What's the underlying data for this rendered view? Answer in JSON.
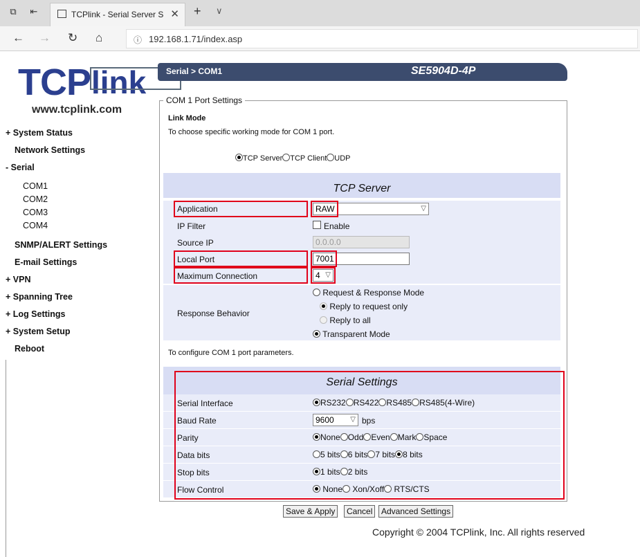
{
  "browser": {
    "tab_title": "TCPlink - Serial Server S",
    "url": "192.168.1.71/index.asp"
  },
  "sidebar": {
    "logo_tcp": "TCP",
    "logo_link": "link",
    "website": "www.tcplink.com",
    "items": [
      {
        "label": "System Status",
        "prefix": "+"
      },
      {
        "label": "Network Settings",
        "prefix": ""
      },
      {
        "label": "Serial",
        "prefix": "-"
      },
      {
        "label": "SNMP/ALERT Settings",
        "prefix": ""
      },
      {
        "label": "E-mail Settings",
        "prefix": ""
      },
      {
        "label": "VPN",
        "prefix": "+"
      },
      {
        "label": "Spanning Tree",
        "prefix": "+"
      },
      {
        "label": "Log Settings",
        "prefix": "+"
      },
      {
        "label": "System Setup",
        "prefix": "+"
      },
      {
        "label": "Reboot",
        "prefix": ""
      }
    ],
    "serial_sub": [
      "COM1",
      "COM2",
      "COM3",
      "COM4"
    ]
  },
  "header": {
    "breadcrumb": "Serial > COM1",
    "model": "SE5904D-4P"
  },
  "port_settings": {
    "legend": "COM 1 Port Settings",
    "link_mode_title": "Link Mode",
    "link_mode_desc": "To choose specific working mode for COM 1 port.",
    "modes": [
      "TCP Server",
      "TCP Client",
      "UDP"
    ],
    "selected_mode": "TCP Server"
  },
  "tcp_server": {
    "title": "TCP Server",
    "application_label": "Application",
    "application_value": "RAW",
    "ip_filter_label": "IP Filter",
    "ip_filter_option": "Enable",
    "source_ip_label": "Source IP",
    "source_ip_value": "0.0.0.0",
    "local_port_label": "Local Port",
    "local_port_value": "7001",
    "max_conn_label": "Maximum Connection",
    "max_conn_value": "4",
    "response_label": "Response Behavior",
    "response_opt1": "Request & Response Mode",
    "response_opt1a": "Reply to request only",
    "response_opt1b": "Reply to all",
    "response_opt2": "Transparent Mode"
  },
  "serial_note": "To configure COM 1 port parameters.",
  "serial_settings": {
    "title": "Serial Settings",
    "interface_label": "Serial Interface",
    "interfaces": [
      "RS232",
      "RS422",
      "RS485",
      "RS485(4-Wire)"
    ],
    "baud_label": "Baud Rate",
    "baud_value": "9600",
    "baud_unit": "bps",
    "parity_label": "Parity",
    "parities": [
      "None",
      "Odd",
      "Even",
      "Mark",
      "Space"
    ],
    "databits_label": "Data bits",
    "databits": [
      "5 bits",
      "6 bits",
      "7 bits",
      "8 bits"
    ],
    "stopbits_label": "Stop bits",
    "stopbits": [
      "1 bits",
      "2 bits"
    ],
    "flow_label": "Flow Control",
    "flows": [
      "None",
      "Xon/Xoff",
      "RTS/CTS"
    ]
  },
  "buttons": {
    "save": "Save & Apply",
    "cancel": "Cancel",
    "advanced": "Advanced Settings"
  },
  "copyright": "Copyright © 2004 TCPlink, Inc. All rights reserved"
}
